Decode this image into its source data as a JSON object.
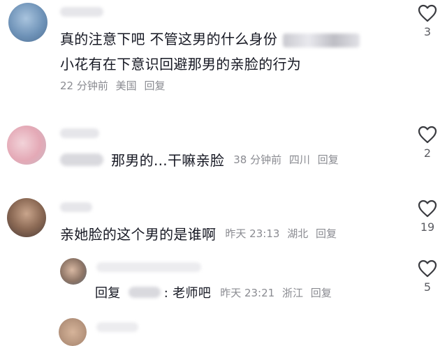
{
  "comments": [
    {
      "text_line1": "真的注意下吧  不管这男的什么身份",
      "text_line2": "小花有在下意识回避那男的亲脸的行为",
      "time": "22 分钟前",
      "location": "美国",
      "reply": "回复",
      "likes": "3"
    },
    {
      "text": "那男的...干嘛亲脸",
      "time": "38 分钟前",
      "location": "四川",
      "reply": "回复",
      "likes": "2"
    },
    {
      "text": "亲她脸的这个男的是谁啊",
      "time": "昨天  23:13",
      "location": "湖北",
      "reply": "回复",
      "likes": "19"
    },
    {
      "reply_prefix": "回复",
      "text": ": 老师吧",
      "time": "昨天  23:21",
      "location": "浙江",
      "reply": "回复",
      "likes": "5"
    }
  ],
  "icons": {
    "like": "heart-outline-icon"
  },
  "colors": {
    "text": "#161823",
    "meta": "#8a8b91",
    "count": "#5c5d63"
  }
}
